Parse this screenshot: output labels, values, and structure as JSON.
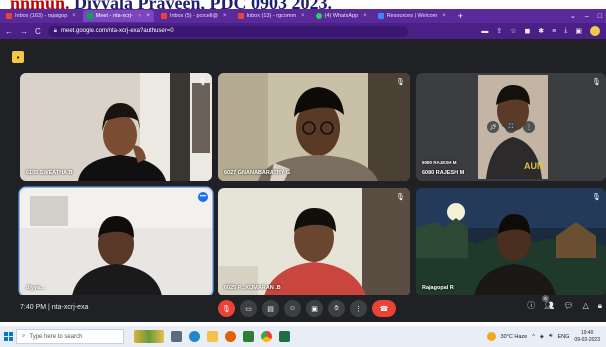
{
  "caption": {
    "prefix": "nnmun.",
    "rest": "Diyyala Praveen, PDC 0903 2023."
  },
  "browser": {
    "tabs": [
      {
        "label": "Inbox (163) - rajaigop",
        "active": false,
        "color": "#ea4335"
      },
      {
        "label": "Meet - nta-xcrj-",
        "active": true,
        "color": "#00ac47"
      },
      {
        "label": "Inbox (5) - pcrcell@",
        "active": false,
        "color": "#ea4335"
      },
      {
        "label": "Inbox (13) - rgcomm",
        "active": false,
        "color": "#ea4335"
      },
      {
        "label": "(4) WhatsApp",
        "active": false,
        "color": "#25d366"
      },
      {
        "label": "Resources | Welcom",
        "active": false,
        "color": "#4285f4"
      }
    ],
    "new_tab": "+",
    "window_controls": [
      "⌄",
      "–",
      "□"
    ],
    "url": "meet.google.com/nta-xcrj-exa?authuser=0",
    "nav": [
      "←",
      "→",
      "C"
    ]
  },
  "meet": {
    "activities_icon": "▪",
    "tiles": [
      {
        "name": "6105 SWEATHA B",
        "mic": "muted"
      },
      {
        "name": "6027 GNANABARATHY G",
        "mic": "muted"
      },
      {
        "name": "6080 RAJESH M",
        "name_small": "6080 RAJESH M",
        "mic": "muted"
      },
      {
        "name": "diyya...",
        "mic": "speaking"
      },
      {
        "name": "6025 P...KUMARAN .B",
        "mic": "muted"
      },
      {
        "name": "Rajagopal R",
        "mic": "muted"
      }
    ],
    "time": "7:40 PM",
    "separator": "|",
    "meeting_code": "nta-xcrj-exa",
    "people_count": "6"
  },
  "taskbar": {
    "search_placeholder": "Type here to search",
    "weather": "30°C  Haze",
    "language": "ENG",
    "clock_time": "19:40",
    "clock_date": "09-03-2023"
  },
  "colors": {
    "meet_bg": "#202124",
    "end_call": "#ea4335",
    "active_ring": "#8ab4f8"
  }
}
